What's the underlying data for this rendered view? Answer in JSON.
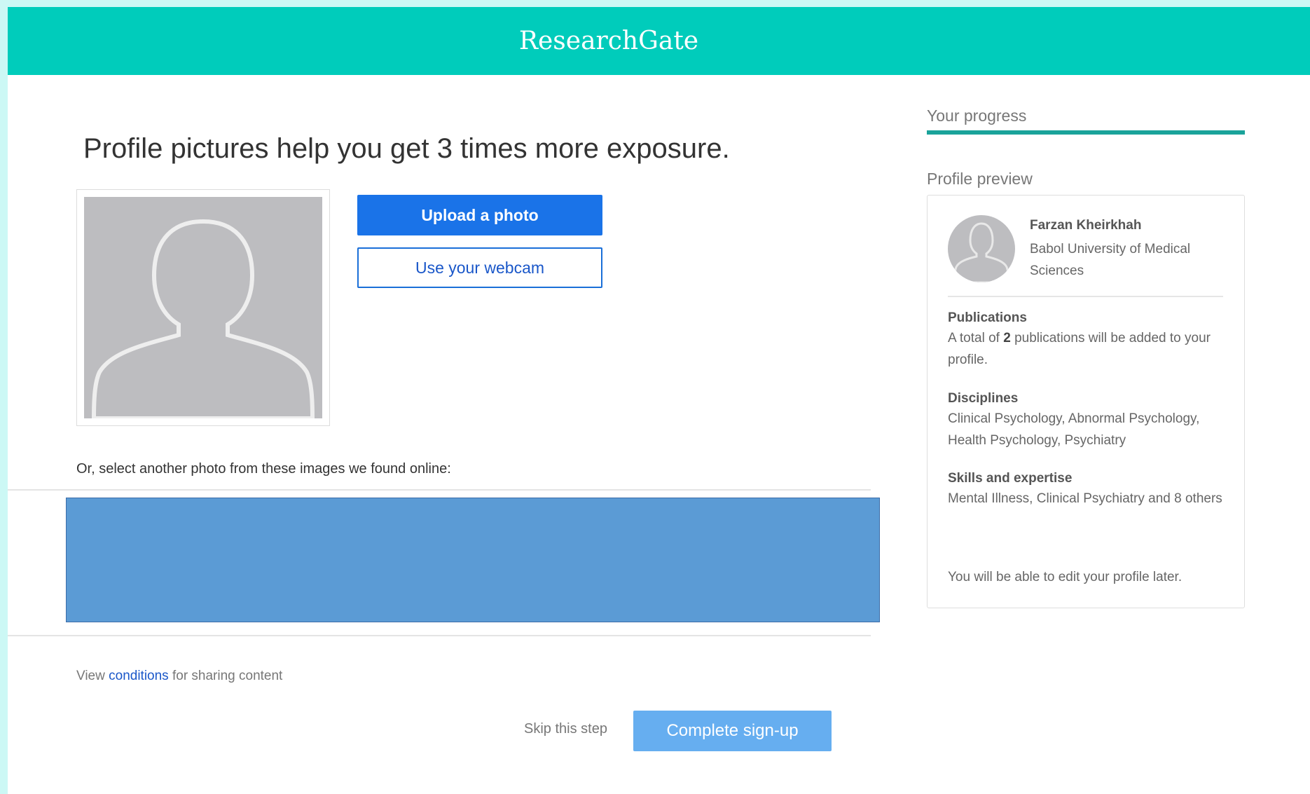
{
  "header": {
    "brand": "ResearchGate"
  },
  "main": {
    "headline": "Profile pictures help you get 3 times more exposure.",
    "upload_button": "Upload a photo",
    "webcam_button": "Use your webcam",
    "select_other_label": "Or, select another photo from these images we found online:",
    "conditions_prefix": "View",
    "conditions_link": "conditions",
    "conditions_suffix": "for sharing content",
    "skip_label": "Skip this step",
    "complete_button": "Complete sign-up"
  },
  "sidebar": {
    "progress_label": "Your progress",
    "progress_fraction": 1.0,
    "preview_label": "Profile preview",
    "profile": {
      "name": "Farzan Kheirkhah",
      "institution": "Babol University of Medical Sciences"
    },
    "publications": {
      "title": "Publications",
      "text_before": "A total of",
      "count": "2",
      "text_after": "publications will be added to your profile."
    },
    "disciplines": {
      "title": "Disciplines",
      "text": "Clinical Psychology, Abnormal Psychology, Health Psychology, Psychiatry"
    },
    "skills": {
      "title": "Skills and expertise",
      "text": "Mental Illness, Clinical Psychiatry and 8 others"
    },
    "footer": "You will be able to edit your profile later."
  },
  "colors": {
    "brand_teal": "#00ccbb",
    "primary_blue": "#1a73e8",
    "complete_blue": "#66aef0",
    "images_placeholder": "#5b9bd5"
  }
}
